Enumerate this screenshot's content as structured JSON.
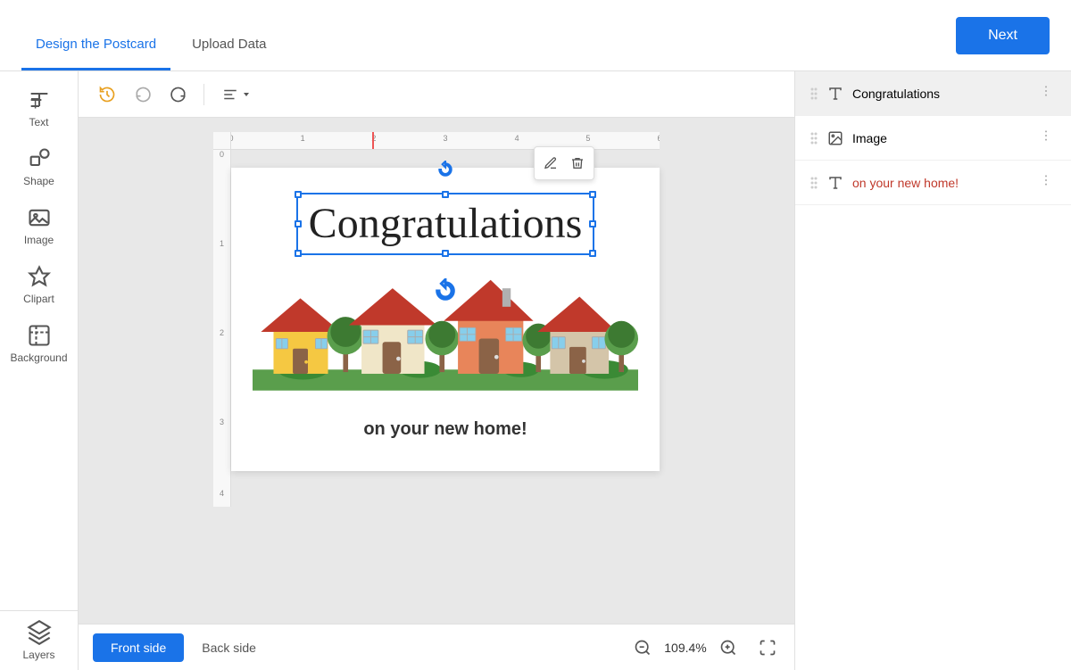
{
  "header": {
    "tab_design": "Design the Postcard",
    "tab_upload": "Upload Data",
    "next_label": "Next"
  },
  "sidebar": {
    "items": [
      {
        "id": "text",
        "label": "Text"
      },
      {
        "id": "shape",
        "label": "Shape"
      },
      {
        "id": "image",
        "label": "Image"
      },
      {
        "id": "clipart",
        "label": "Clipart"
      },
      {
        "id": "background",
        "label": "Background"
      },
      {
        "id": "layers",
        "label": "Layers"
      }
    ]
  },
  "canvas": {
    "congratulations": "Congratulations",
    "sub_text": "on your new home!",
    "zoom_level": "109.4%"
  },
  "layers_panel": {
    "items": [
      {
        "id": "congratulations",
        "label": "Congratulations",
        "type": "text",
        "active": true
      },
      {
        "id": "image",
        "label": "Image",
        "type": "image"
      },
      {
        "id": "sub_text",
        "label": "on your new home!",
        "type": "text",
        "highlighted": true
      }
    ]
  },
  "bottom": {
    "front_label": "Front side",
    "back_label": "Back side"
  }
}
